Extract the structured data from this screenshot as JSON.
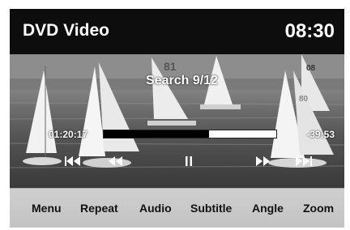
{
  "header": {
    "title": "DVD Video",
    "clock": "08:30"
  },
  "playback": {
    "search_label": "Search 9/12",
    "elapsed": "01:20:17",
    "remaining": "-39:53",
    "progress_fraction": 0.61,
    "controls": [
      {
        "name": "previous-chapter",
        "icon": "skip-previous-icon"
      },
      {
        "name": "rewind",
        "icon": "rewind-icon"
      },
      {
        "name": "pause",
        "icon": "pause-icon"
      },
      {
        "name": "fast-forward",
        "icon": "fast-forward-icon"
      },
      {
        "name": "next-chapter",
        "icon": "skip-next-icon"
      }
    ]
  },
  "menu": {
    "items": [
      {
        "label": "Menu"
      },
      {
        "label": "Repeat"
      },
      {
        "label": "Audio"
      },
      {
        "label": "Subtitle"
      },
      {
        "label": "Angle"
      },
      {
        "label": "Zoom"
      }
    ]
  },
  "scene": {
    "sail_numbers": [
      "81",
      "08",
      "80"
    ]
  },
  "colors": {
    "titlebar": "#0d0d0d",
    "menubar": "#c9c9c9",
    "text_light": "#ffffff",
    "progress_fill": "#000000"
  }
}
